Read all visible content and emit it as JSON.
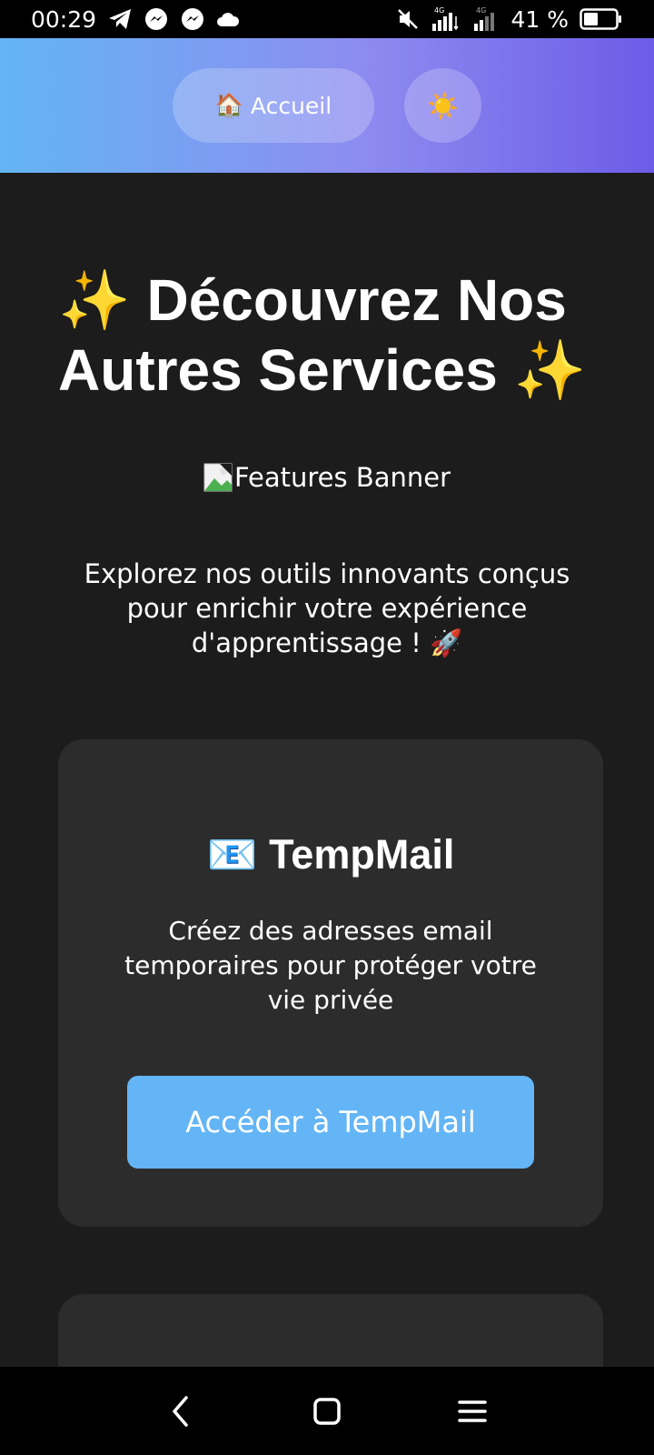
{
  "status_bar": {
    "time": "00:29",
    "battery_percent": "41 %",
    "network_label_1": "4G",
    "network_label_2": "4G"
  },
  "header": {
    "home_label": "Accueil",
    "home_icon": "house-emoji",
    "theme_icon": "sun-emoji"
  },
  "main": {
    "title": "✨ Découvrez Nos Autres Services ✨",
    "banner_alt": "Features Banner",
    "intro": "Explorez nos outils innovants conçus pour enrichir votre expérience d'apprentissage ! 🚀"
  },
  "cards": [
    {
      "title": "📧 TempMail",
      "description": "Créez des adresses email temporaires pour protéger votre vie privée",
      "button_label": "Accéder à TempMail"
    }
  ],
  "colors": {
    "header_gradient_start": "#63b5f3",
    "header_gradient_end": "#6c5ce7",
    "background": "#1c1c1c",
    "card_background": "#2c2c2c",
    "button_accent": "#64b5f6"
  }
}
